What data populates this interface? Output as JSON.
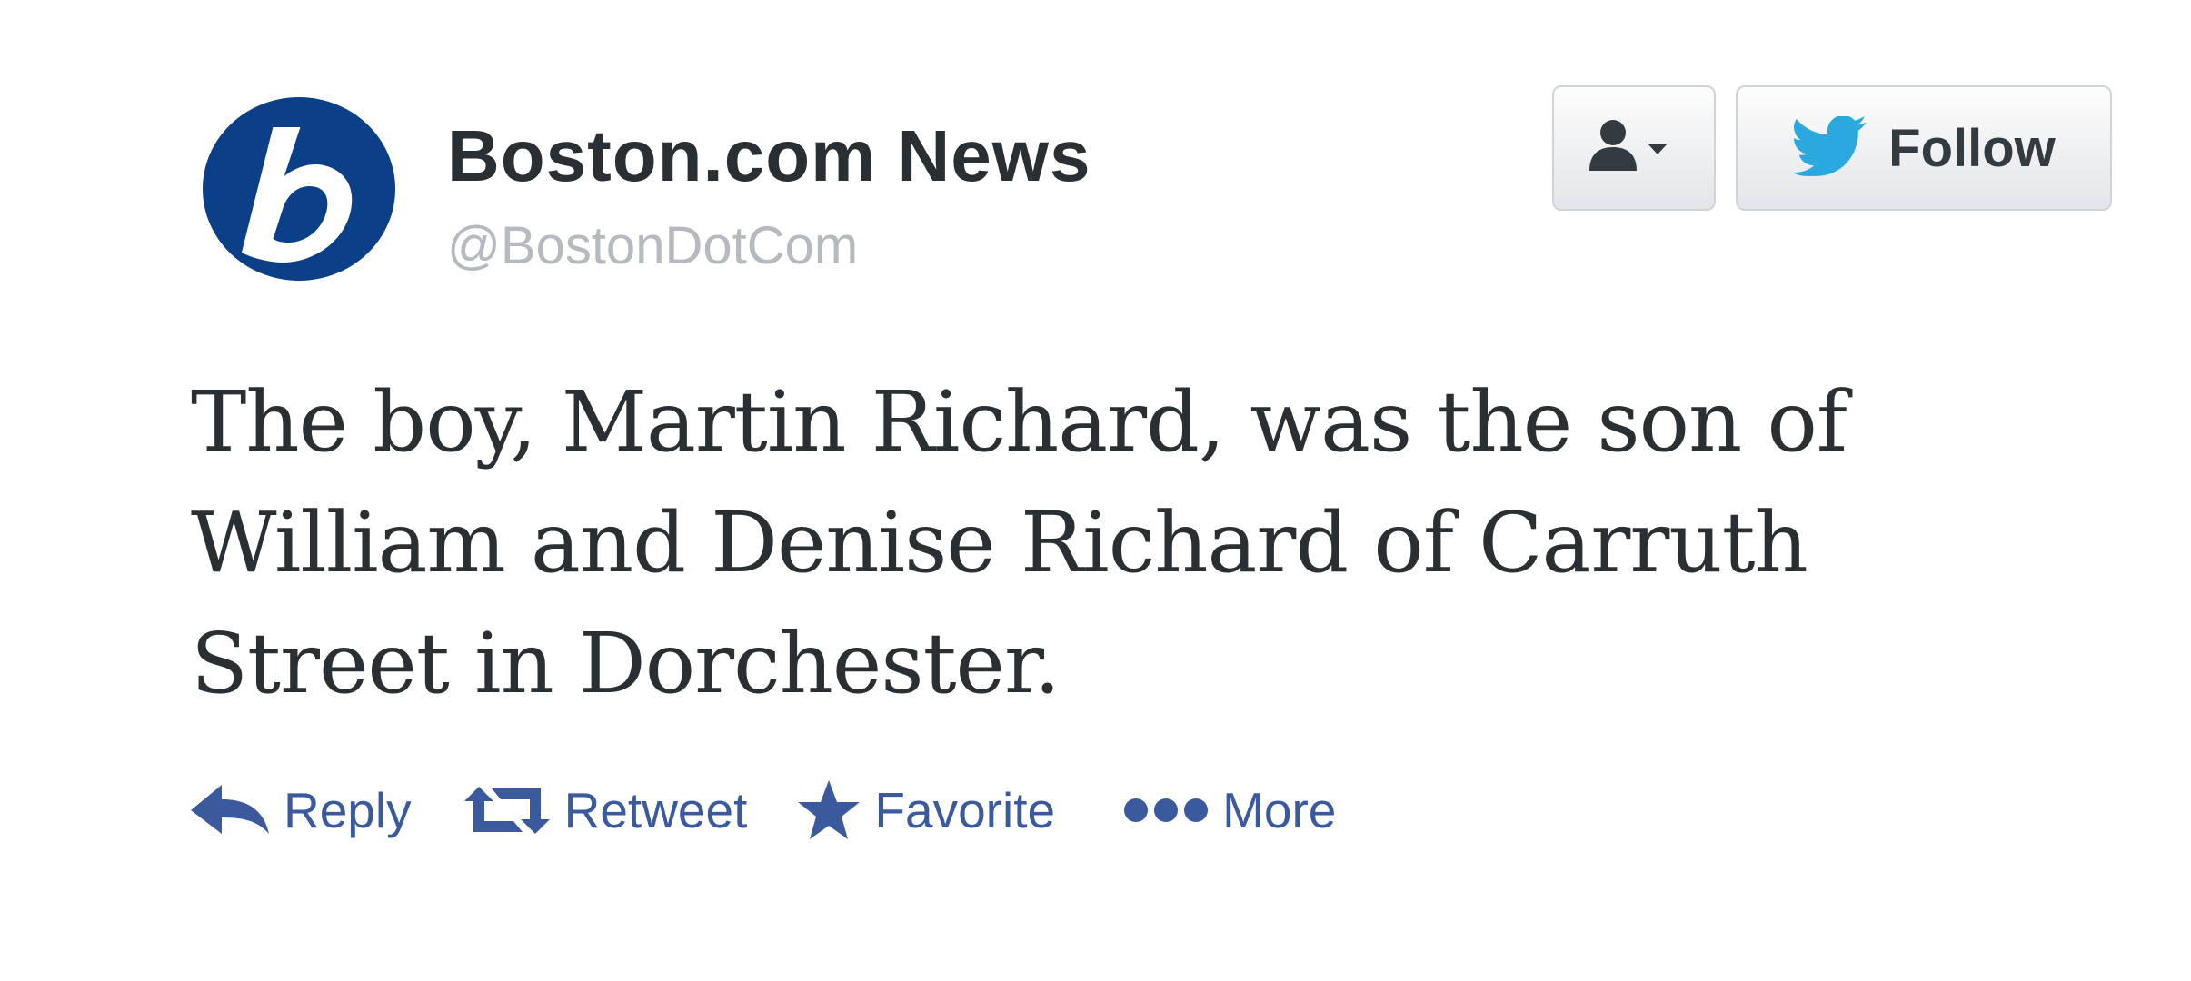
{
  "tweet": {
    "author": {
      "display_name": "Boston.com News",
      "handle": "@BostonDotCom",
      "avatar_icon": "boston-b-logo",
      "avatar_color": "#0b3f88"
    },
    "text_lines": [
      "The boy, Martin Richard, was the son of",
      "William and Denise Richard of Carruth",
      "Street in Dorchester."
    ],
    "buttons": {
      "user_dropdown_icon": "user-dropdown-icon",
      "follow_label": "Follow",
      "follow_icon": "twitter-bird-icon"
    },
    "actions": [
      {
        "label": "Reply",
        "icon": "reply-icon"
      },
      {
        "label": "Retweet",
        "icon": "retweet-icon"
      },
      {
        "label": "Favorite",
        "icon": "star-icon"
      },
      {
        "label": "More",
        "icon": "more-dots-icon"
      }
    ],
    "colors": {
      "action_blue": "#3b5a9e",
      "twitter_blue": "#2aa9e0",
      "text_dark": "#292f33",
      "handle_gray": "#b4bac0"
    }
  }
}
